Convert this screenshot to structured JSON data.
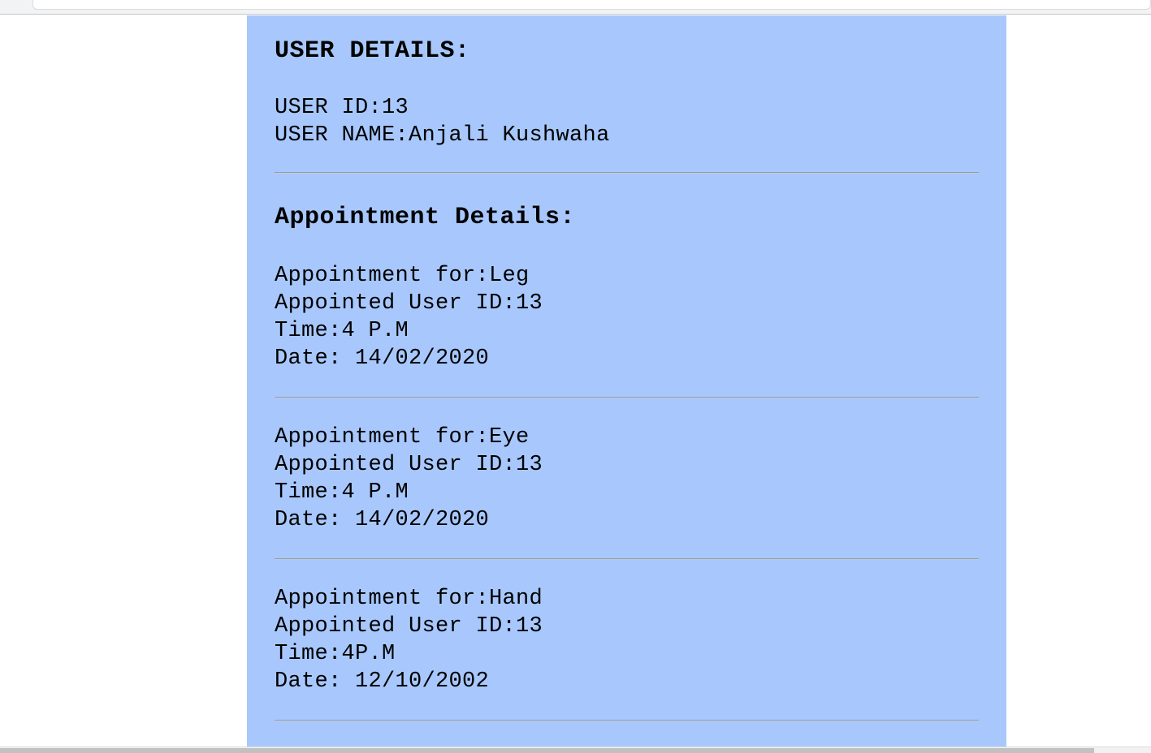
{
  "user_section": {
    "title": "USER DETAILS:",
    "user_id": "USER ID:13",
    "user_name": "USER NAME:Anjali Kushwaha"
  },
  "appointment_section": {
    "title": "Appointment Details:",
    "appointments": [
      {
        "for": "Appointment for:Leg",
        "user_id": "Appointed User ID:13",
        "time": "Time:4 P.M",
        "date": "Date: 14/02/2020"
      },
      {
        "for": "Appointment for:Eye",
        "user_id": "Appointed User ID:13",
        "time": "Time:4 P.M",
        "date": "Date: 14/02/2020"
      },
      {
        "for": "Appointment for:Hand",
        "user_id": "Appointed User ID:13",
        "time": "Time:4P.M",
        "date": "Date: 12/10/2002"
      }
    ]
  },
  "colors": {
    "panel_background": "#a8c8fd",
    "page_background": "#ffffff",
    "divider": "#8f9db3"
  }
}
